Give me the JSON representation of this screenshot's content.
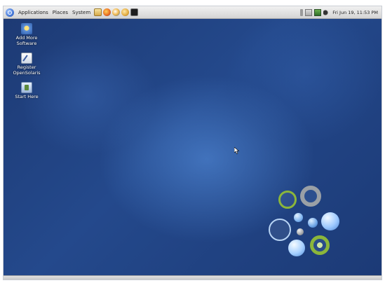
{
  "top_panel": {
    "menus": [
      "Applications",
      "Places",
      "System"
    ],
    "launchers": [
      "home-folder-icon",
      "firefox-icon",
      "thunderbird-icon",
      "file-manager-icon",
      "terminal-icon"
    ],
    "tray_icons": [
      "power-icon",
      "network-icon",
      "update-icon",
      "volume-icon"
    ],
    "clock": "Fri Jun 19, 11:53 PM"
  },
  "desktop": {
    "icons": [
      {
        "label": "Add More Software",
        "icon": "add-software-icon"
      },
      {
        "label": "Register OpenSolaris",
        "icon": "register-icon"
      },
      {
        "label": "Start Here",
        "icon": "start-here-icon"
      }
    ]
  },
  "colors": {
    "wallpaper": "#24498c",
    "panel": "#e0e0e0",
    "ring_green": "#8bb63b",
    "ring_gray": "#9aa0a6",
    "bubble_blue": "#9cc8ff"
  }
}
